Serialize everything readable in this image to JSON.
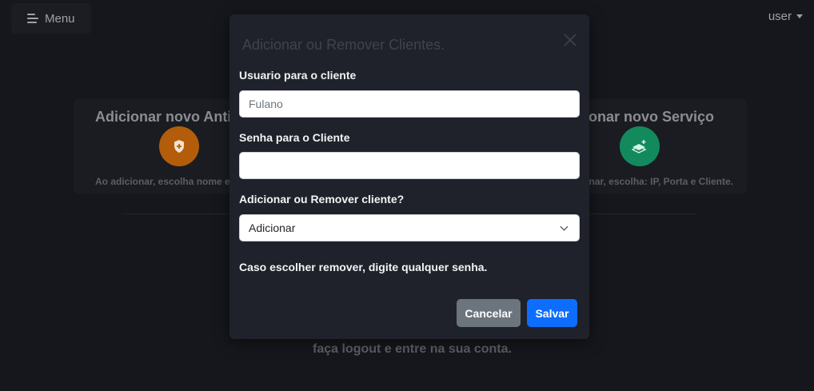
{
  "topbar": {
    "menu_label": "Menu",
    "user_label": "user"
  },
  "cards": {
    "left": {
      "title": "Adicionar novo Anti-C",
      "description": "Ao adicionar, escolha nome e",
      "icon": "shield-plus-icon",
      "color": "#b35d0a"
    },
    "right": {
      "title": "cionar novo Serviço",
      "description": "nar, escolha: IP, Porta e Cliente.",
      "icon": "layers-plus-icon",
      "color": "#128a5d"
    }
  },
  "footer_text": "faça logout e entre na sua conta.",
  "modal": {
    "title": "Adicionar ou Remover Clientes.",
    "user_label": "Usuario para o cliente",
    "user_placeholder": "Fulano",
    "password_label": "Senha para o Cliente",
    "password_value": "",
    "action_label": "Adicionar ou Remover cliente?",
    "action_selected": "Adicionar",
    "hint": "Caso escolher remover, digite qualquer senha.",
    "cancel_label": "Cancelar",
    "save_label": "Salvar"
  },
  "colors": {
    "background": "#15171c",
    "modal_bg": "#1f222a",
    "primary": "#0d6efd",
    "secondary": "#6c757d"
  }
}
